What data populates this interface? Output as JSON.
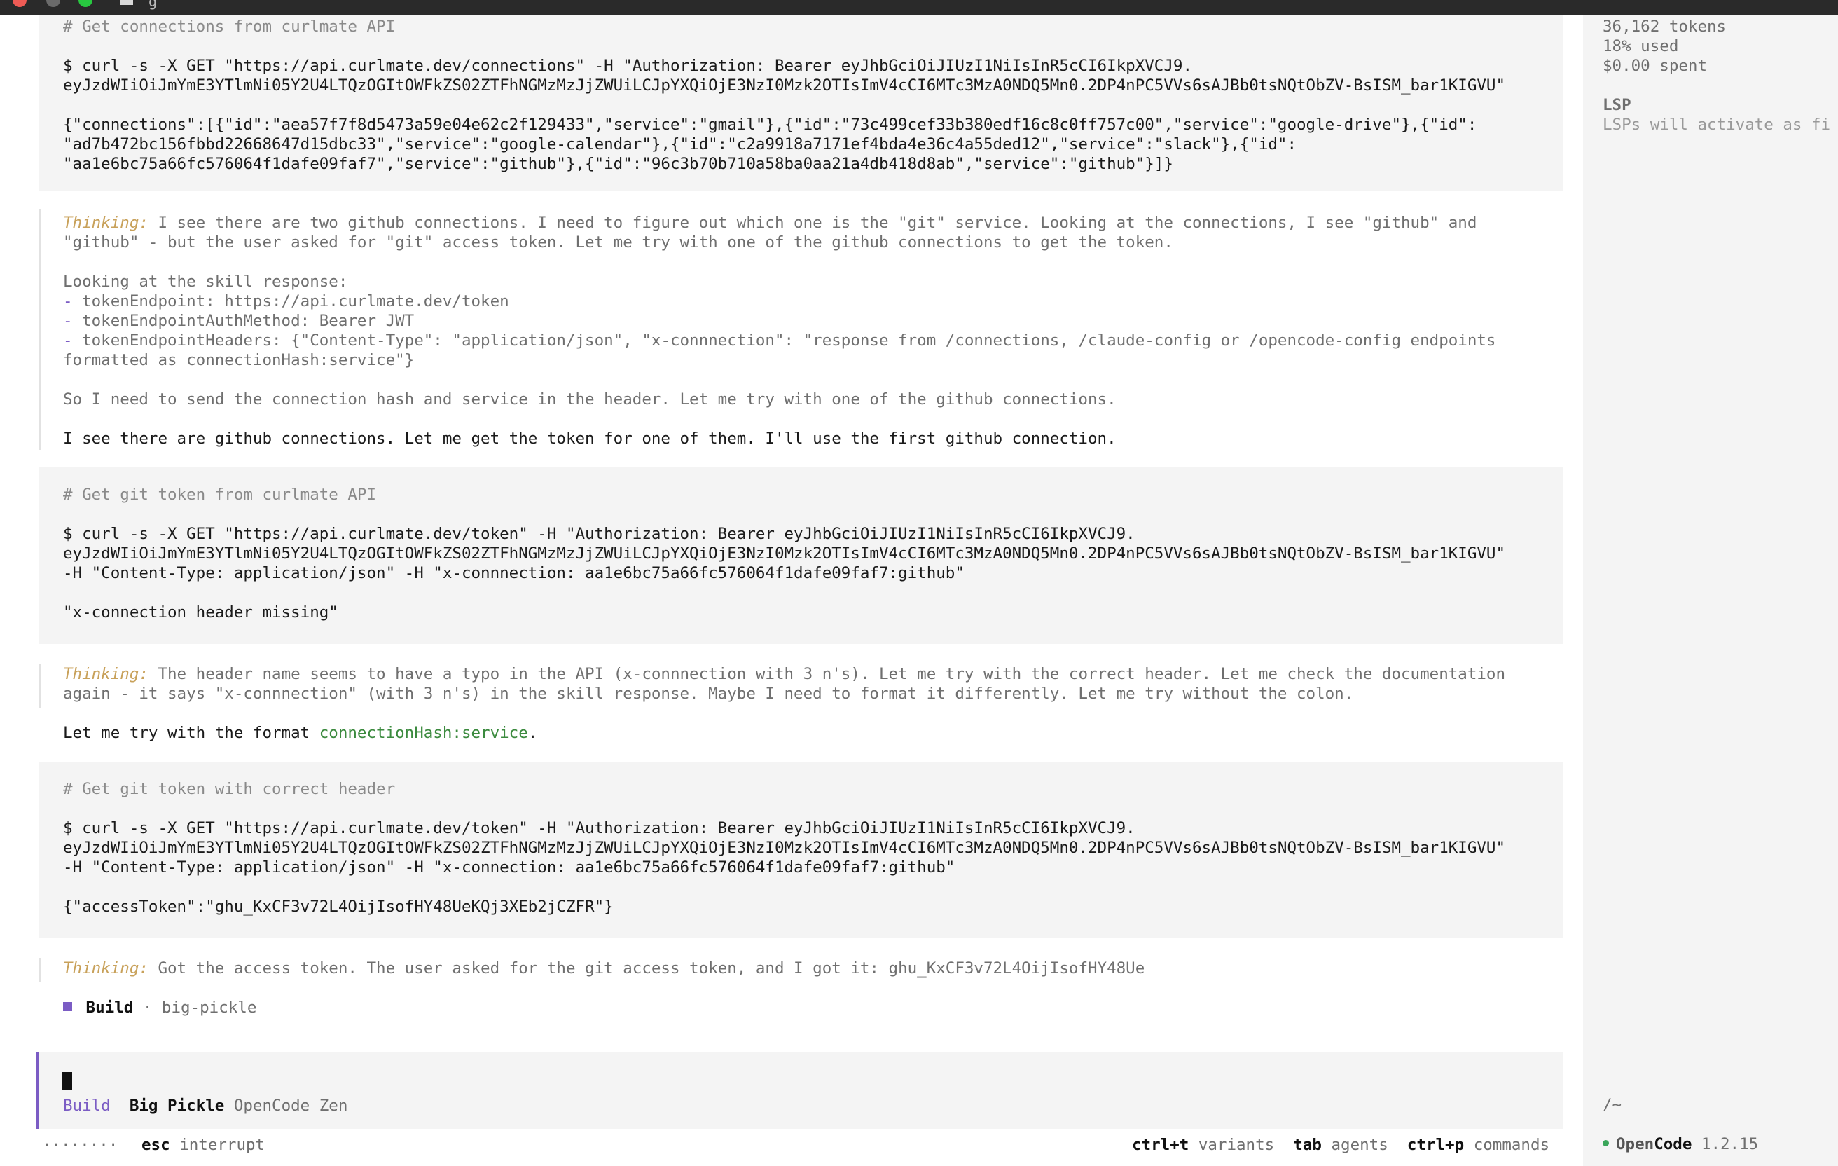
{
  "window": {
    "tab_title": "g"
  },
  "blocks": [
    {
      "comment": "# Get connections from curlmate API",
      "cmd": [
        "$ curl -s -X GET \"https://api.curlmate.dev/connections\" -H \"Authorization: Bearer eyJhbGciOiJIUzI1NiIsInR5cCI6IkpXVCJ9.",
        "eyJzdWIiOiJmYmE3YTlmNi05Y2U4LTQzOGItOWFkZS02ZTFhNGMzMzJjZWUiLCJpYXQiOjE3NzI0Mzk2OTIsImV4cCI6MTc3MzA0NDQ5Mn0.2DP4nPC5VVs6sAJBb0tsNQtObZV-BsISM_bar1KIGVU\""
      ],
      "output": [
        "{\"connections\":[{\"id\":\"aea57f7f8d5473a59e04e62c2f129433\",\"service\":\"gmail\"},{\"id\":\"73c499cef33b380edf16c8c0ff757c00\",\"service\":\"google-drive\"},{\"id\":",
        "\"ad7b472bc156fbbd22668647d15dbc33\",\"service\":\"google-calendar\"},{\"id\":\"c2a9918a7171ef4bda4e36c4a55ded12\",\"service\":\"slack\"},{\"id\":",
        "\"aa1e6bc75a66fc576064f1dafe09faf7\",\"service\":\"github\"},{\"id\":\"96c3b70b710a58ba0aa21a4db418d8ab\",\"service\":\"github\"}]}"
      ]
    },
    {
      "comment": "# Get git token from curlmate API",
      "cmd": [
        "$ curl -s -X GET \"https://api.curlmate.dev/token\" -H \"Authorization: Bearer eyJhbGciOiJIUzI1NiIsInR5cCI6IkpXVCJ9.",
        "eyJzdWIiOiJmYmE3YTlmNi05Y2U4LTQzOGItOWFkZS02ZTFhNGMzMzJjZWUiLCJpYXQiOjE3NzI0Mzk2OTIsImV4cCI6MTc3MzA0NDQ5Mn0.2DP4nPC5VVs6sAJBb0tsNQtObZV-BsISM_bar1KIGVU\"",
        "-H \"Content-Type: application/json\" -H \"x-connnection: aa1e6bc75a66fc576064f1dafe09faf7:github\""
      ],
      "output": [
        "\"x-connection header missing\""
      ]
    },
    {
      "comment": "# Get git token with correct header",
      "cmd": [
        "$ curl -s -X GET \"https://api.curlmate.dev/token\" -H \"Authorization: Bearer eyJhbGciOiJIUzI1NiIsInR5cCI6IkpXVCJ9.",
        "eyJzdWIiOiJmYmE3YTlmNi05Y2U4LTQzOGItOWFkZS02ZTFhNGMzMzJjZWUiLCJpYXQiOjE3NzI0Mzk2OTIsImV4cCI6MTc3MzA0NDQ5Mn0.2DP4nPC5VVs6sAJBb0tsNQtObZV-BsISM_bar1KIGVU\"",
        "-H \"Content-Type: application/json\" -H \"x-connection: aa1e6bc75a66fc576064f1dafe09faf7:github\""
      ],
      "output": [
        "{\"accessToken\":\"ghu_KxCF3v72L4OijIsofHY48UeKQj3XEb2jCZFR\"}"
      ]
    }
  ],
  "thinking_label": "Thinking:",
  "thinking1": {
    "l1": " I see there are two github connections. I need to figure out which one is the \"git\" service. Looking at the connections, I see \"github\" and",
    "l2": "\"github\" - but the user asked for \"git\" access token. Let me try with one of the github connections to get the token.",
    "l3": "Looking at the skill response:",
    "dash": "-",
    "b1": " tokenEndpoint: https://api.curlmate.dev/token",
    "b2": " tokenEndpointAuthMethod: Bearer JWT",
    "b3": " tokenEndpointHeaders: {\"Content-Type\": \"application/json\", \"x-connnection\": \"response from /connections, /claude-config or /opencode-config endpoints",
    "b3b": "formatted as connectionHash:service\"}",
    "l4": "So I need to send the connection hash and service in the header. Let me try with one of the github connections."
  },
  "message1": "I see there are github connections. Let me get the token for one of them. I'll use the first github connection.",
  "thinking2": {
    "l1": " The header name seems to have a typo in the API (x-connnection with 3 n's). Let me try with the correct header. Let me check the documentation",
    "l2": "again - it says \"x-connnection\" (with 3 n's) in the skill response. Maybe I need to format it differently. Let me try without the colon."
  },
  "message2": {
    "pre": "Let me try with the format ",
    "code": "connectionHash:service",
    "post": "."
  },
  "thinking3": " Got the access token. The user asked for the git access token, and I got it: ghu_KxCF3v72L4OijIsofHY48Ue",
  "build_status": {
    "mode": "Build",
    "sep": " · ",
    "model": "big-pickle"
  },
  "input": {
    "mode": "Build",
    "model": "Big Pickle",
    "provider": "OpenCode Zen"
  },
  "footer": {
    "spinner": "········",
    "esc_key": "esc",
    "esc_label": "interrupt",
    "k1": "ctrl+t",
    "k1_label": "variants",
    "k2": "tab",
    "k2_label": "agents",
    "k3": "ctrl+p",
    "k3_label": "commands"
  },
  "sidebar": {
    "tokens": "36,162 tokens",
    "used": "18% used",
    "spent": "$0.00 spent",
    "lsp_title": "LSP",
    "lsp_text": "LSPs will activate as fi",
    "path": "/~",
    "brand_open": "Open",
    "brand_code": "Code",
    "version": "1.2.15"
  },
  "colors": {
    "accent": "#7b5cc4",
    "thinking": "#c8a15a",
    "code": "#3b8a3e",
    "status_dot": "#3aa65a"
  }
}
